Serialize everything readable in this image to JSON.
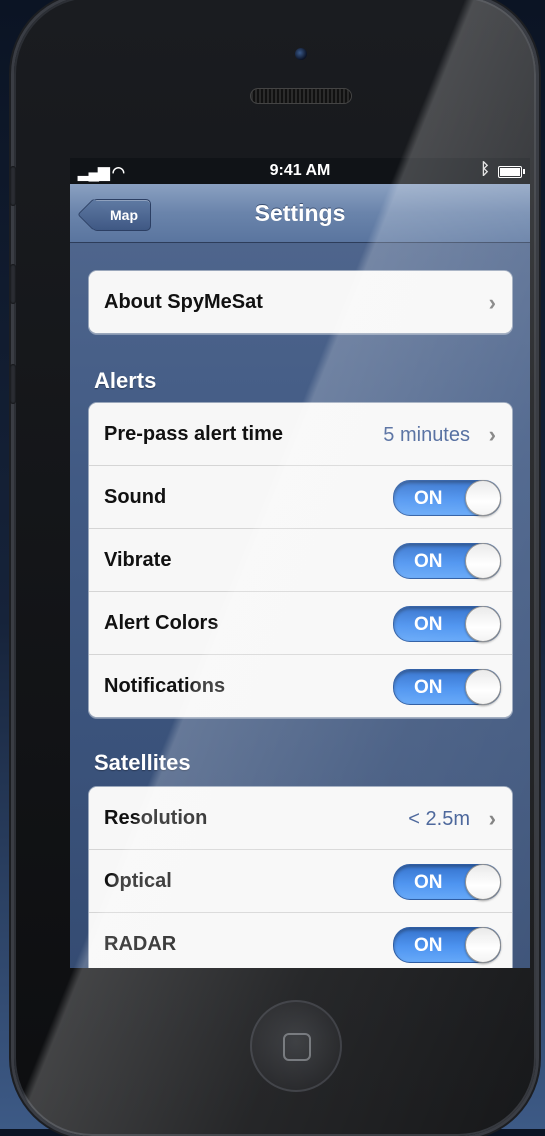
{
  "status_bar": {
    "time": "9:41 AM",
    "signal_icon": "signal-wifi-icon",
    "bluetooth_icon": "bluetooth-icon",
    "battery_icon": "battery-icon"
  },
  "nav": {
    "back_label": "Map",
    "title": "Settings"
  },
  "about": {
    "label": "About SpyMeSat"
  },
  "alerts": {
    "header": "Alerts",
    "prepass_label": "Pre-pass alert time",
    "prepass_value": "5 minutes",
    "toggles": [
      {
        "label": "Sound",
        "state": "ON"
      },
      {
        "label": "Vibrate",
        "state": "ON"
      },
      {
        "label": "Alert Colors",
        "state": "ON"
      },
      {
        "label": "Notifications",
        "state": "ON"
      }
    ]
  },
  "satellites": {
    "header": "Satellites",
    "resolution_label": "Resolution",
    "resolution_value": "< 2.5m",
    "toggles": [
      {
        "label": "Optical",
        "state": "ON"
      },
      {
        "label": "RADAR",
        "state": "ON"
      }
    ]
  },
  "colors": {
    "toggle_on": "#3f8bef",
    "navbar": "#6a84ab",
    "value_text": "#3d5a93"
  }
}
